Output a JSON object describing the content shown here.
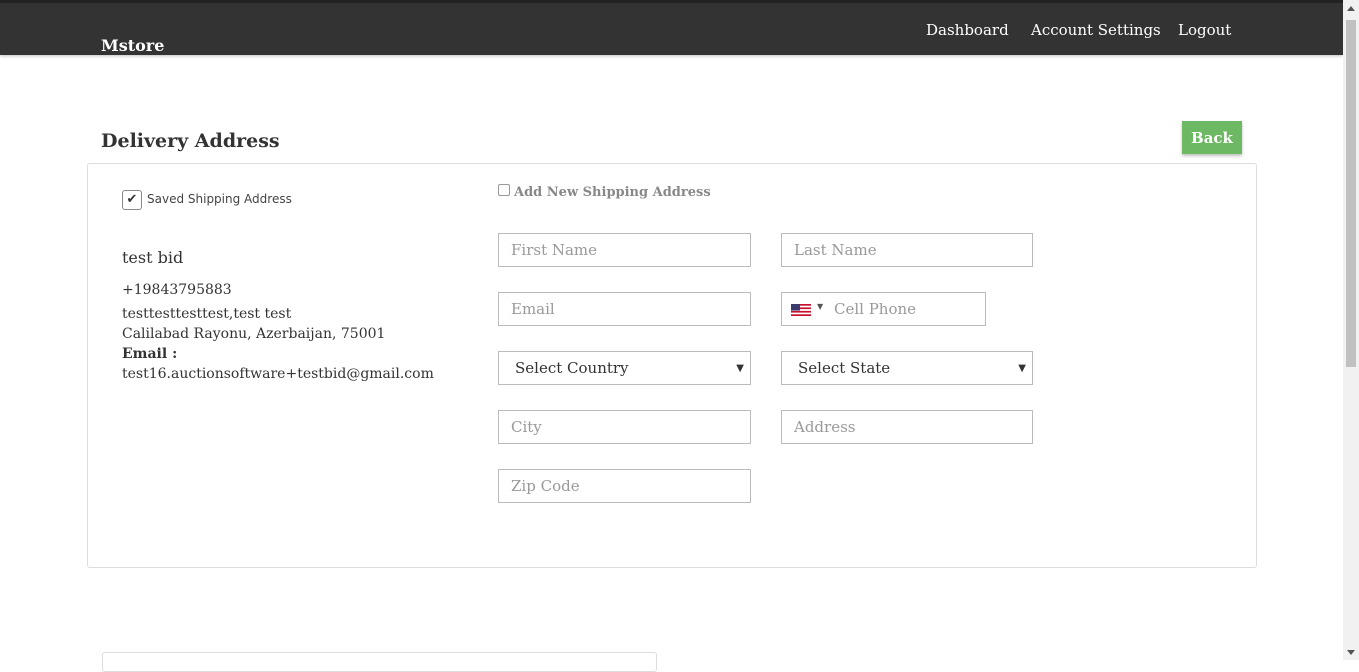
{
  "header": {
    "brand": "Mstore",
    "nav": [
      "Dashboard",
      "Account Settings",
      "Logout"
    ]
  },
  "page": {
    "title": "Delivery Address",
    "back_label": "Back"
  },
  "saved_address": {
    "checkbox_label": "Saved Shipping Address",
    "checked": true,
    "name": "test bid",
    "phone": "+19843795883",
    "street": "testtesttesttest,test test",
    "city_line": "Calilabad Rayonu, Azerbaijan, 75001",
    "email_label": "Email :",
    "email": "test16.auctionsoftware+testbid@gmail.com"
  },
  "new_address": {
    "checkbox_label": "Add New Shipping Address",
    "checked": false,
    "first_name_placeholder": "First Name",
    "last_name_placeholder": "Last Name",
    "email_placeholder": "Email",
    "phone_placeholder": "Cell Phone",
    "phone_country_icon": "us-flag-icon",
    "country_select": "Select Country",
    "state_select": "Select State",
    "city_placeholder": "City",
    "address_placeholder": "Address",
    "zip_placeholder": "Zip Code"
  },
  "colors": {
    "header_bg": "#333333",
    "back_button": "#6db862"
  }
}
